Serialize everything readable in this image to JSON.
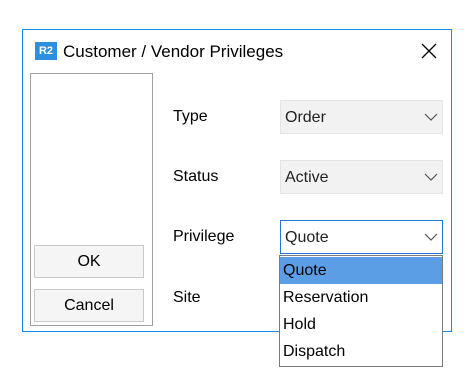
{
  "dialog": {
    "app_icon_text": "R2",
    "title": "Customer / Vendor Privileges"
  },
  "buttons": {
    "ok": "OK",
    "cancel": "Cancel"
  },
  "fields": {
    "type_label": "Type",
    "type_value": "Order",
    "status_label": "Status",
    "status_value": "Active",
    "privilege_label": "Privilege",
    "privilege_value": "Quote",
    "site_label": "Site"
  },
  "privilege_options": [
    "Quote",
    "Reservation",
    "Hold",
    "Dispatch"
  ],
  "selected_option": "Quote",
  "colors": {
    "accent": "#1e88e5",
    "highlight": "#5b9ee6"
  }
}
